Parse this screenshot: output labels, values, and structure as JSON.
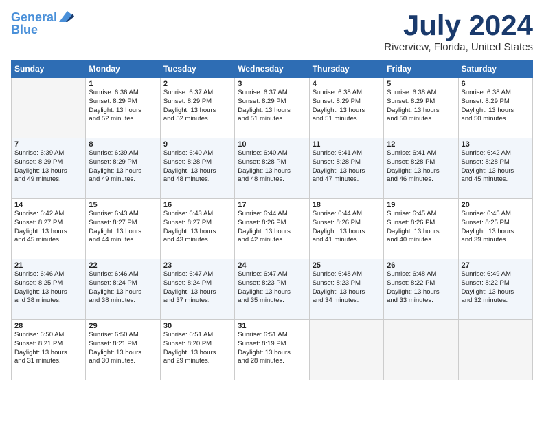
{
  "header": {
    "logo_line1": "General",
    "logo_line2": "Blue",
    "month": "July 2024",
    "location": "Riverview, Florida, United States"
  },
  "days_of_week": [
    "Sunday",
    "Monday",
    "Tuesday",
    "Wednesday",
    "Thursday",
    "Friday",
    "Saturday"
  ],
  "weeks": [
    [
      {
        "day": "",
        "info": ""
      },
      {
        "day": "1",
        "info": "Sunrise: 6:36 AM\nSunset: 8:29 PM\nDaylight: 13 hours\nand 52 minutes."
      },
      {
        "day": "2",
        "info": "Sunrise: 6:37 AM\nSunset: 8:29 PM\nDaylight: 13 hours\nand 52 minutes."
      },
      {
        "day": "3",
        "info": "Sunrise: 6:37 AM\nSunset: 8:29 PM\nDaylight: 13 hours\nand 51 minutes."
      },
      {
        "day": "4",
        "info": "Sunrise: 6:38 AM\nSunset: 8:29 PM\nDaylight: 13 hours\nand 51 minutes."
      },
      {
        "day": "5",
        "info": "Sunrise: 6:38 AM\nSunset: 8:29 PM\nDaylight: 13 hours\nand 50 minutes."
      },
      {
        "day": "6",
        "info": "Sunrise: 6:38 AM\nSunset: 8:29 PM\nDaylight: 13 hours\nand 50 minutes."
      }
    ],
    [
      {
        "day": "7",
        "info": "Sunrise: 6:39 AM\nSunset: 8:29 PM\nDaylight: 13 hours\nand 49 minutes."
      },
      {
        "day": "8",
        "info": "Sunrise: 6:39 AM\nSunset: 8:29 PM\nDaylight: 13 hours\nand 49 minutes."
      },
      {
        "day": "9",
        "info": "Sunrise: 6:40 AM\nSunset: 8:28 PM\nDaylight: 13 hours\nand 48 minutes."
      },
      {
        "day": "10",
        "info": "Sunrise: 6:40 AM\nSunset: 8:28 PM\nDaylight: 13 hours\nand 48 minutes."
      },
      {
        "day": "11",
        "info": "Sunrise: 6:41 AM\nSunset: 8:28 PM\nDaylight: 13 hours\nand 47 minutes."
      },
      {
        "day": "12",
        "info": "Sunrise: 6:41 AM\nSunset: 8:28 PM\nDaylight: 13 hours\nand 46 minutes."
      },
      {
        "day": "13",
        "info": "Sunrise: 6:42 AM\nSunset: 8:28 PM\nDaylight: 13 hours\nand 45 minutes."
      }
    ],
    [
      {
        "day": "14",
        "info": "Sunrise: 6:42 AM\nSunset: 8:27 PM\nDaylight: 13 hours\nand 45 minutes."
      },
      {
        "day": "15",
        "info": "Sunrise: 6:43 AM\nSunset: 8:27 PM\nDaylight: 13 hours\nand 44 minutes."
      },
      {
        "day": "16",
        "info": "Sunrise: 6:43 AM\nSunset: 8:27 PM\nDaylight: 13 hours\nand 43 minutes."
      },
      {
        "day": "17",
        "info": "Sunrise: 6:44 AM\nSunset: 8:26 PM\nDaylight: 13 hours\nand 42 minutes."
      },
      {
        "day": "18",
        "info": "Sunrise: 6:44 AM\nSunset: 8:26 PM\nDaylight: 13 hours\nand 41 minutes."
      },
      {
        "day": "19",
        "info": "Sunrise: 6:45 AM\nSunset: 8:26 PM\nDaylight: 13 hours\nand 40 minutes."
      },
      {
        "day": "20",
        "info": "Sunrise: 6:45 AM\nSunset: 8:25 PM\nDaylight: 13 hours\nand 39 minutes."
      }
    ],
    [
      {
        "day": "21",
        "info": "Sunrise: 6:46 AM\nSunset: 8:25 PM\nDaylight: 13 hours\nand 38 minutes."
      },
      {
        "day": "22",
        "info": "Sunrise: 6:46 AM\nSunset: 8:24 PM\nDaylight: 13 hours\nand 38 minutes."
      },
      {
        "day": "23",
        "info": "Sunrise: 6:47 AM\nSunset: 8:24 PM\nDaylight: 13 hours\nand 37 minutes."
      },
      {
        "day": "24",
        "info": "Sunrise: 6:47 AM\nSunset: 8:23 PM\nDaylight: 13 hours\nand 35 minutes."
      },
      {
        "day": "25",
        "info": "Sunrise: 6:48 AM\nSunset: 8:23 PM\nDaylight: 13 hours\nand 34 minutes."
      },
      {
        "day": "26",
        "info": "Sunrise: 6:48 AM\nSunset: 8:22 PM\nDaylight: 13 hours\nand 33 minutes."
      },
      {
        "day": "27",
        "info": "Sunrise: 6:49 AM\nSunset: 8:22 PM\nDaylight: 13 hours\nand 32 minutes."
      }
    ],
    [
      {
        "day": "28",
        "info": "Sunrise: 6:50 AM\nSunset: 8:21 PM\nDaylight: 13 hours\nand 31 minutes."
      },
      {
        "day": "29",
        "info": "Sunrise: 6:50 AM\nSunset: 8:21 PM\nDaylight: 13 hours\nand 30 minutes."
      },
      {
        "day": "30",
        "info": "Sunrise: 6:51 AM\nSunset: 8:20 PM\nDaylight: 13 hours\nand 29 minutes."
      },
      {
        "day": "31",
        "info": "Sunrise: 6:51 AM\nSunset: 8:19 PM\nDaylight: 13 hours\nand 28 minutes."
      },
      {
        "day": "",
        "info": ""
      },
      {
        "day": "",
        "info": ""
      },
      {
        "day": "",
        "info": ""
      }
    ]
  ]
}
